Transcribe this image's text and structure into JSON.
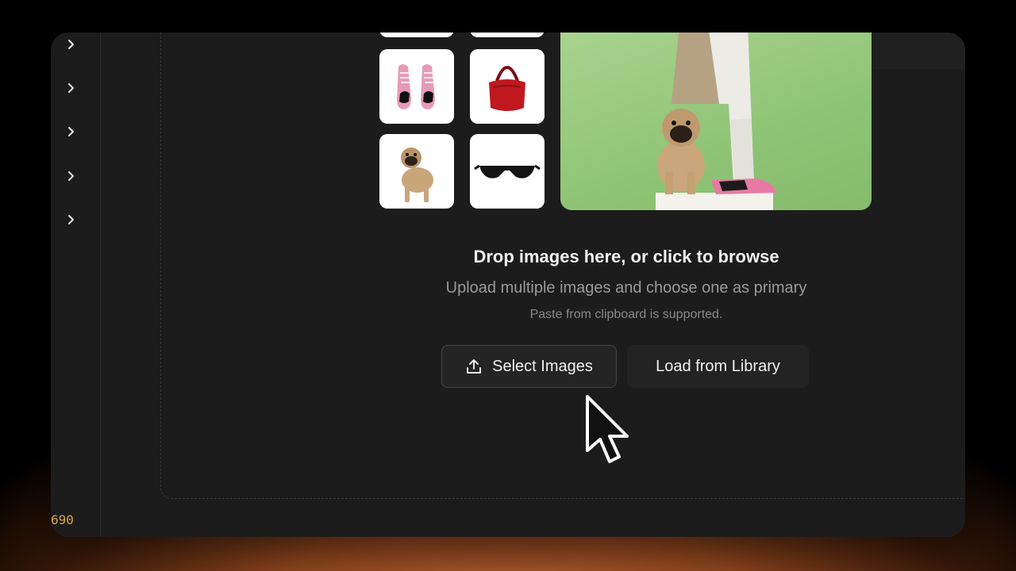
{
  "sidebar": {
    "expanders": [
      {
        "icon": "chevron-right-icon"
      },
      {
        "icon": "chevron-right-icon"
      },
      {
        "icon": "chevron-right-icon"
      },
      {
        "icon": "chevron-right-icon"
      },
      {
        "icon": "chevron-right-icon"
      }
    ],
    "line_number": "690"
  },
  "gallery": {
    "thumbnails": [
      {
        "subject": "pink-sneakers"
      },
      {
        "subject": "red-handbag"
      },
      {
        "subject": "pug-dog"
      },
      {
        "subject": "black-sunglasses"
      }
    ],
    "preview": {
      "subject": "pug-and-person-on-green-backdrop"
    }
  },
  "upload": {
    "title": "Drop images here, or click to browse",
    "subtitle": "Upload multiple images and choose one as primary",
    "note": "Paste from clipboard is supported.",
    "select_label": "Select Images",
    "library_label": "Load from Library"
  },
  "colors": {
    "frame_bg": "#1c1c1c",
    "text_primary": "#f2f2f2",
    "text_secondary": "#9a9a9a",
    "line_number": "#d9a24a",
    "backdrop_green": "#a9d48f"
  }
}
